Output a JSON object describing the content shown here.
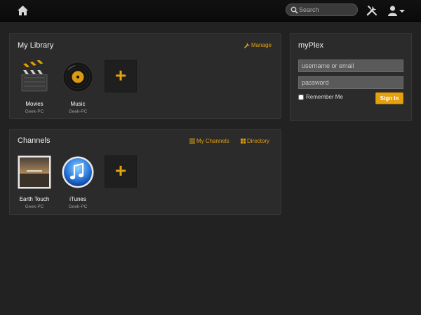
{
  "topbar": {
    "search_placeholder": "Search",
    "home_icon": "home-icon",
    "tools_icon": "tools-icon",
    "user_icon": "user-icon"
  },
  "library": {
    "title": "My Library",
    "manage_label": "Manage",
    "items": [
      {
        "label": "Movies",
        "server": "Geek-PC",
        "icon": "clapperboard-icon"
      },
      {
        "label": "Music",
        "server": "Geek-PC",
        "icon": "vinyl-record-icon"
      }
    ],
    "add_label": "+"
  },
  "channels": {
    "title": "Channels",
    "my_channels_label": "My Channels",
    "directory_label": "Directory",
    "items": [
      {
        "label": "Earth Touch",
        "server": "Geek-PC",
        "icon": "earth-touch-thumbnail"
      },
      {
        "label": "iTunes",
        "server": "Geek-PC",
        "icon": "itunes-icon"
      }
    ],
    "add_label": "+"
  },
  "myplex": {
    "title": "myPlex",
    "username_placeholder": "username or email",
    "password_placeholder": "password",
    "remember_label": "Remember Me",
    "signin_label": "Sign In"
  },
  "colors": {
    "accent": "#e5a00d",
    "background": "#222222",
    "panel": "#2b2b2b",
    "topbar": "#0f0f0f"
  }
}
